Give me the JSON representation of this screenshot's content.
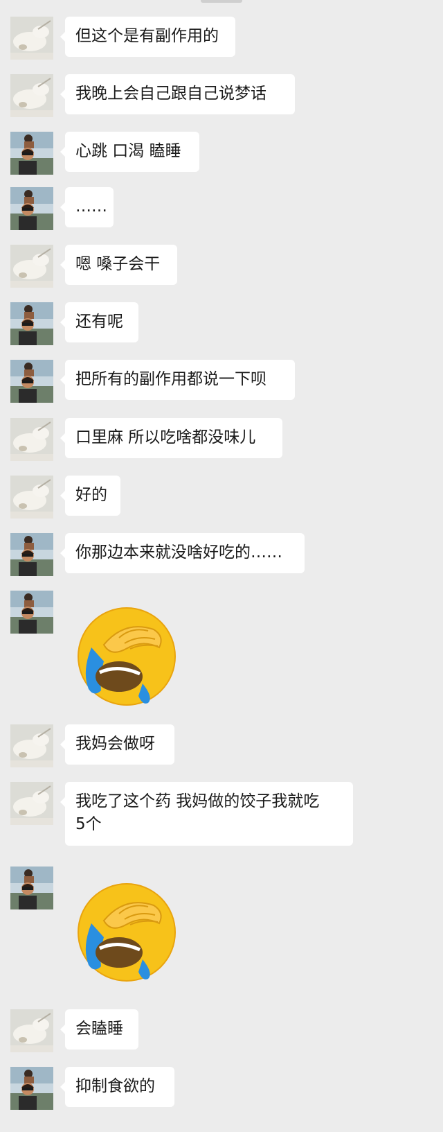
{
  "messages": [
    {
      "sender": "A",
      "text": "但这个是有副作用的"
    },
    {
      "sender": "A",
      "text": "我晚上会自己跟自己说梦话"
    },
    {
      "sender": "B",
      "text": "心跳 口渴 瞌睡"
    },
    {
      "sender": "B",
      "text": "……"
    },
    {
      "sender": "A",
      "text": "嗯 嗓子会干"
    },
    {
      "sender": "B",
      "text": "还有呢"
    },
    {
      "sender": "B",
      "text": "把所有的副作用都说一下呗"
    },
    {
      "sender": "A",
      "text": "口里麻 所以吃啥都没味儿"
    },
    {
      "sender": "A",
      "text": "好的"
    },
    {
      "sender": "B",
      "text": "你那边本来就没啥好吃的……"
    },
    {
      "sender": "B",
      "sticker": "facepalm-crying-emoji"
    },
    {
      "sender": "A",
      "text": "我妈会做呀"
    },
    {
      "sender": "A",
      "text": "我吃了这个药 我妈做的饺子我就吃\n5个"
    },
    {
      "sender": "B",
      "sticker": "facepalm-crying-emoji"
    },
    {
      "sender": "A",
      "text": "会瞌睡"
    },
    {
      "sender": "B",
      "text": "抑制食欲的"
    }
  ],
  "colors": {
    "background": "#ececec",
    "bubble": "#ffffff",
    "emoji_face": "#f7c21a",
    "emoji_tears": "#2a8fe0"
  }
}
